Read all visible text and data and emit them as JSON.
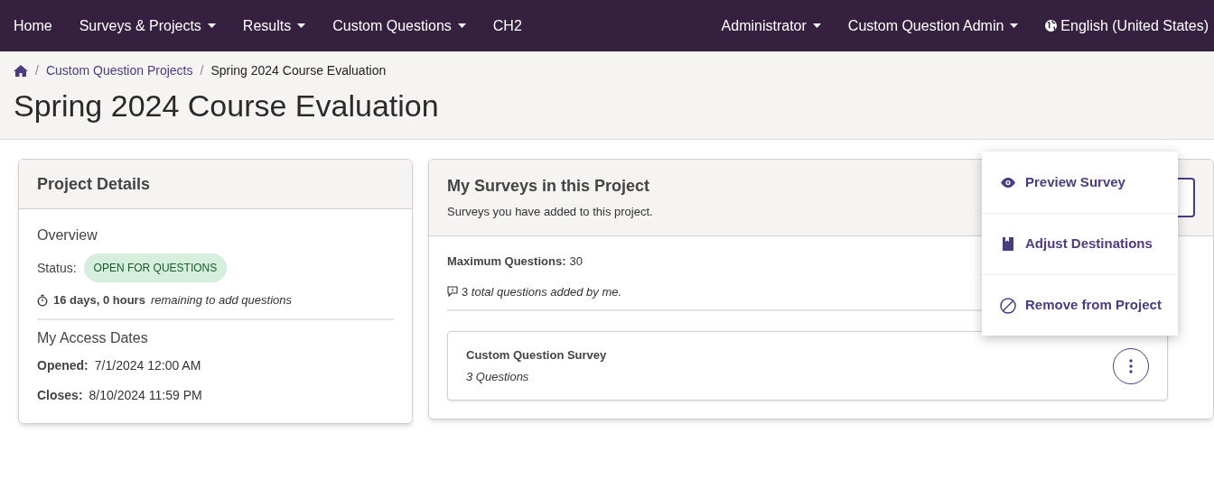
{
  "nav": {
    "left": [
      {
        "label": "Home",
        "dropdown": false
      },
      {
        "label": "Surveys & Projects",
        "dropdown": true
      },
      {
        "label": "Results",
        "dropdown": true
      },
      {
        "label": "Custom Questions",
        "dropdown": true
      },
      {
        "label": "CH2",
        "dropdown": false
      }
    ],
    "right": [
      {
        "label": "Administrator",
        "dropdown": true,
        "kind": "account"
      },
      {
        "label": "Custom Question Admin",
        "dropdown": true,
        "kind": "account"
      },
      {
        "label": "English (United States)",
        "dropdown": false,
        "kind": "language"
      }
    ]
  },
  "breadcrumb": [
    {
      "label": "/",
      "kind": "separator"
    },
    {
      "label": "Custom Question Projects",
      "kind": "link"
    },
    {
      "label": "/",
      "kind": "separator"
    },
    {
      "label": "Spring 2024 Course Evaluation",
      "kind": "current"
    }
  ],
  "page_title": "Spring 2024 Course Evaluation",
  "project_details": {
    "title": "Project Details",
    "overview_heading": "Overview",
    "status_label": "Status:",
    "status": "OPEN FOR QUESTIONS",
    "time_left": "16 days, 0 hours",
    "time_note": "remaining to add questions",
    "access_heading": "My Access Dates",
    "dates": [
      {
        "label": "Opened:",
        "value": "7/1/2024 12:00 AM"
      },
      {
        "label": "Closes:",
        "value": "8/10/2024 11:59 PM"
      }
    ]
  },
  "my_surveys": {
    "title": "My Surveys in this Project",
    "subtitle": "Surveys you have added to this project.",
    "max_label": "Maximum Questions:",
    "max_value": "30",
    "total_note": "3 *total questions added by me.*",
    "surveys": [
      {
        "name": "Custom Question Survey",
        "questions": "3 Questions"
      }
    ]
  },
  "menu": [
    {
      "label": "Preview Survey"
    },
    {
      "label": "Adjust Destinations"
    },
    {
      "label": "Remove from Project"
    }
  ]
}
